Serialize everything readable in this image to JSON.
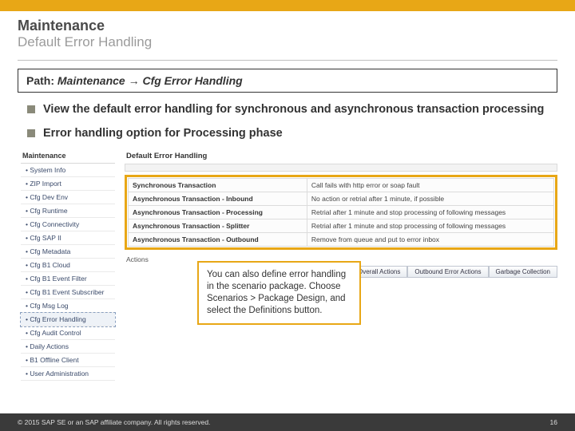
{
  "heading": {
    "title": "Maintenance",
    "subtitle": "Default Error Handling"
  },
  "path": {
    "label": "Path:  ",
    "value": "Maintenance → Cfg Error Handling"
  },
  "bullets": [
    "View the default error handling for synchronous and asynchronous transaction processing",
    "Error handling option for Processing phase"
  ],
  "sidebar": {
    "header": "Maintenance",
    "items": [
      "System Info",
      "ZIP Import",
      "Cfg Dev Env",
      "Cfg Runtime",
      "Cfg Connectivity",
      "Cfg SAP II",
      "Cfg Metadata",
      "Cfg B1 Cloud",
      "Cfg B1 Event Filter",
      "Cfg B1 Event Subscriber",
      "Cfg Msg Log",
      "Cfg Error Handling",
      "Cfg Audit Control",
      "Daily Actions",
      "B1 Offline Client",
      "User Administration"
    ],
    "active_index": 11
  },
  "panel": {
    "header": "Default Error Handling",
    "rows": [
      {
        "k": "Synchronous Transaction",
        "v": "Call fails with http error or soap fault"
      },
      {
        "k": "Asynchronous Transaction - Inbound",
        "v": "No action or retrial after 1 minute, if possible"
      },
      {
        "k": "Asynchronous Transaction - Processing",
        "v": "Retrial after 1 minute and stop processing of following messages"
      },
      {
        "k": "Asynchronous Transaction - Splitter",
        "v": "Retrial after 1 minute and stop processing of following messages"
      },
      {
        "k": "Asynchronous Transaction - Outbound",
        "v": "Remove from queue and put to error inbox"
      }
    ],
    "actions_label": "Actions",
    "buttons": [
      "Overall Actions",
      "Outbound Error Actions",
      "Garbage Collection"
    ]
  },
  "note": "You can also define error handling in the scenario package. Choose Scenarios > Package Design, and select the Definitions button.",
  "footer": {
    "copyright": "©  2015 SAP SE or an SAP affiliate company. All rights reserved.",
    "page": "16"
  }
}
